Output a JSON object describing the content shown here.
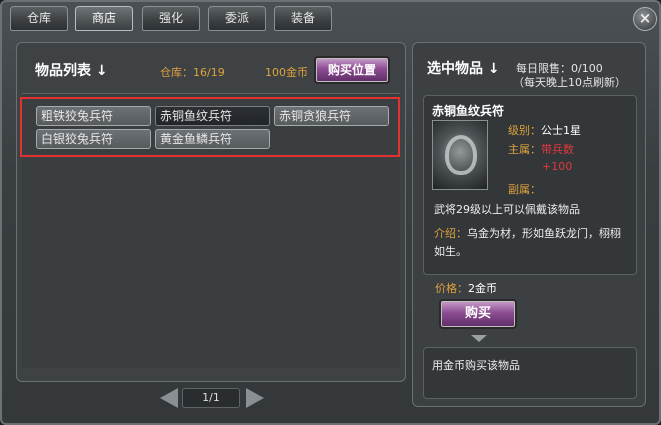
{
  "tabs": [
    "仓库",
    "商店",
    "强化",
    "委派",
    "装备"
  ],
  "active_tab_index": 1,
  "close_label": "×",
  "left": {
    "title": "物品列表",
    "title_arrow": "↓",
    "stock": "仓库：16/19",
    "gold": "100金币",
    "buy_position_button": "购买位置",
    "items": [
      "粗铁狡兔兵符",
      "赤铜鱼纹兵符",
      "赤铜贪狼兵符",
      "白银狡兔兵符",
      "黄金鱼鳞兵符"
    ],
    "selected_index": 1,
    "pager": "1/1"
  },
  "right": {
    "title": "选中物品",
    "title_arrow": "↓",
    "daily_limit": "每日限售：0/100",
    "refresh_note": "（每天晚上10点刷新）",
    "item_name": "赤铜鱼纹兵符",
    "level_key": "级别：",
    "level_val": "公士1星",
    "main_attr_key": "主属：",
    "main_attr_val": "带兵数",
    "main_attr_bonus": "+100",
    "sub_attr_key": "副属：",
    "requirement": "武将29级以上可以佩戴该物品",
    "intro_key": "介绍：",
    "intro_text": "乌金为材，形如鱼跃龙门，栩栩如生。",
    "price_key": "价格：",
    "price_val": "2金币",
    "buy_button": "购买",
    "hint": "用金币购买该物品"
  }
}
